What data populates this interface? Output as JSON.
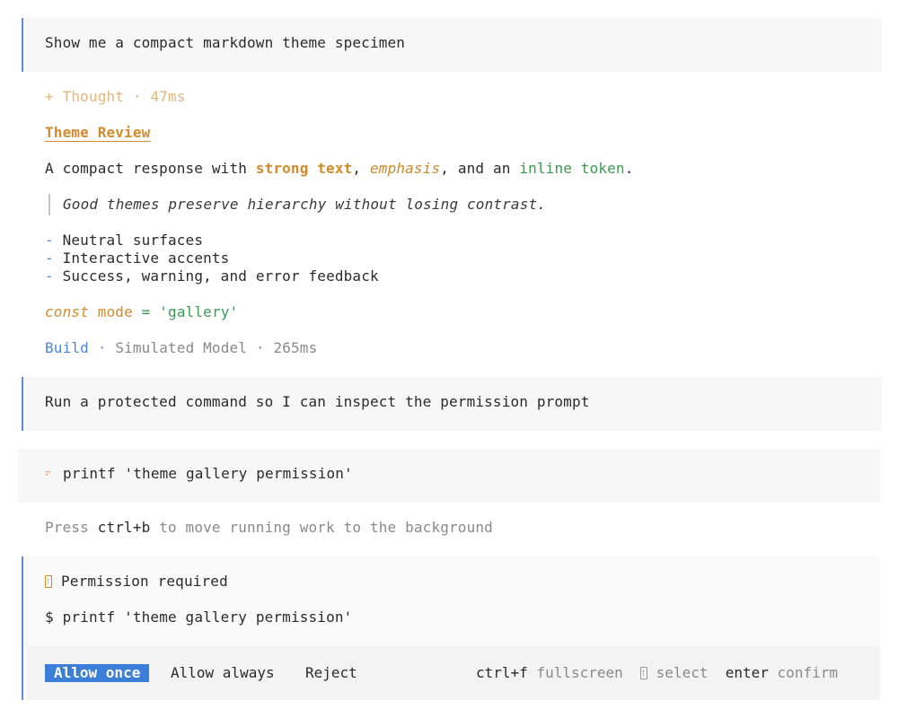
{
  "prompt1": {
    "text": "Show me a compact markdown theme specimen"
  },
  "thought": {
    "prefix": "+",
    "label": "Thought",
    "sep": "·",
    "duration": "47ms"
  },
  "response": {
    "heading": "Theme Review",
    "para_prefix": "A compact response with ",
    "strong": "strong text",
    "comma": ", ",
    "emphasis": "emphasis",
    "mid": ", and an ",
    "inline_code": "inline token",
    "period": ".",
    "quote": "Good themes preserve hierarchy without losing contrast.",
    "bullet_marker": "-",
    "bullets": [
      "Neutral surfaces",
      "Interactive accents",
      "Success, warning, and error feedback"
    ],
    "code": {
      "kw": "const",
      "ident": "mode",
      "op": "=",
      "str": "'gallery'"
    }
  },
  "footer": {
    "agent": "Build",
    "sep": "·",
    "model": "Simulated Model",
    "duration": "265ms"
  },
  "prompt2": {
    "text": "Run a protected command so I can inspect the permission prompt"
  },
  "command": {
    "icon": "spinner-icon",
    "text": "printf 'theme gallery permission'"
  },
  "bg_hint": {
    "pre": "Press ",
    "key": "ctrl+b",
    "post": " to move running work to the background"
  },
  "permission": {
    "title": "Permission required",
    "command_prefix": "$",
    "command": "printf 'theme gallery permission'",
    "buttons": {
      "allow_once": "Allow once",
      "allow_always": "Allow always",
      "reject": "Reject"
    },
    "hints": {
      "fullscreen_key": "ctrl+f",
      "fullscreen_label": "fullscreen",
      "select_label": "select",
      "confirm_key": "enter",
      "confirm_label": "confirm"
    }
  },
  "colors": {
    "accent_blue": "#3b7fd9",
    "accent_orange": "#d38b2e",
    "accent_green": "#3a9a52",
    "panel_bg": "#f7f7f7",
    "muted": "#8a8a8a"
  }
}
